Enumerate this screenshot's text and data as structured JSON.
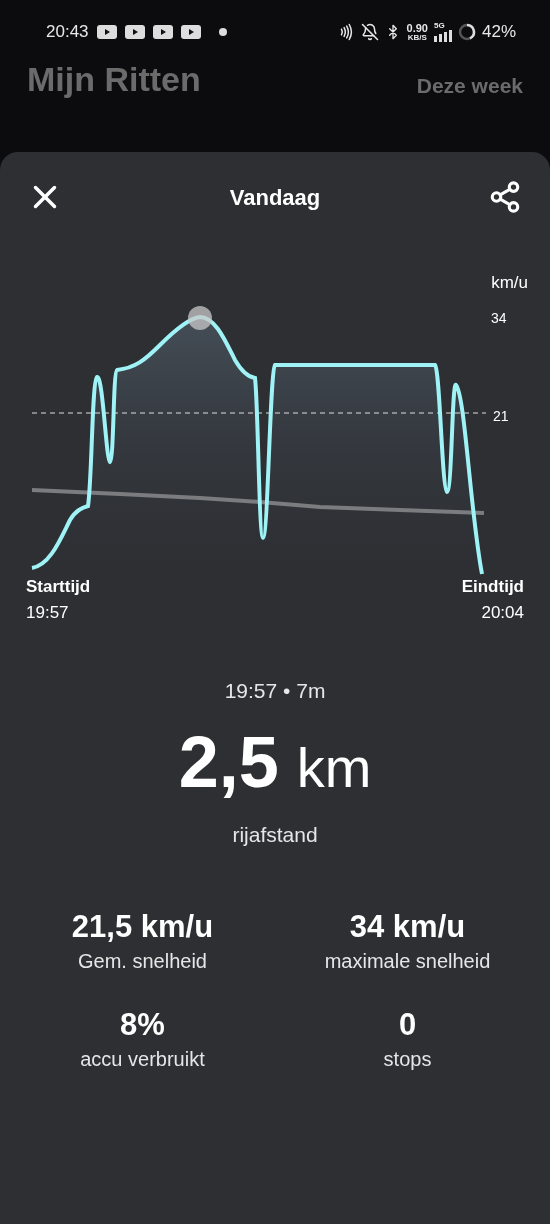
{
  "status_bar": {
    "time": "20:43",
    "speed": "0.90",
    "speed_unit": "KB/S",
    "network": "5G",
    "battery": "42%"
  },
  "header": {
    "title": "Mijn Ritten",
    "period": "Deze week"
  },
  "sheet": {
    "title": "Vandaag"
  },
  "chart": {
    "unit": "km/u",
    "ticks": [
      "34",
      "21"
    ],
    "start_label": "Starttijd",
    "start_time": "19:57",
    "end_label": "Eindtijd",
    "end_time": "20:04"
  },
  "summary": {
    "subtitle": "19:57 • 7m",
    "distance": "2,5",
    "distance_unit": "km",
    "distance_label": "rijafstand"
  },
  "stats": [
    {
      "value": "21,5 km/u",
      "label": "Gem. snelheid"
    },
    {
      "value": "34 km/u",
      "label": "maximale snelheid"
    },
    {
      "value": "8%",
      "label": "accu verbruikt"
    },
    {
      "value": "0",
      "label": "stops"
    }
  ]
}
